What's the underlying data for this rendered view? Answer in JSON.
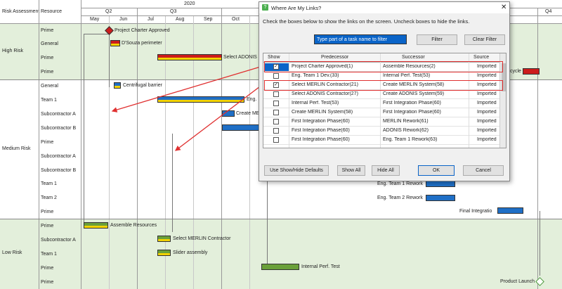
{
  "gantt": {
    "col_risk": "Risk Assessment",
    "col_resource": "Resource",
    "year": "2020",
    "quarters": [
      "Q2",
      "Q3",
      "Q4"
    ],
    "months": [
      "May",
      "Jun",
      "Jul",
      "Aug",
      "Sep",
      "Oct"
    ],
    "risk_groups": [
      "High Risk",
      "Medium Risk",
      "Low Risk"
    ],
    "resources": [
      "Prime",
      "General",
      "Prime",
      "Prime",
      "General",
      "Team 1",
      "Subcontractor A",
      "Subcontractor B",
      "Prime",
      "Subcontractor A",
      "Subcontractor B",
      "Team 1",
      "Team 2",
      "Prime",
      "Prime",
      "Subcontractor A",
      "Team 1",
      "Prime",
      "Prime"
    ],
    "task_labels": {
      "charter": "Project Charter Approved",
      "dsouza": "D'Souza perimeter",
      "adonis": "Select ADONIS Contr",
      "cycle": "cycle",
      "barrier": "Centrifugal barrier",
      "eng": "Eng.",
      "create_merlin": "Create MER",
      "rework1": "Eng. Team 1 Rework",
      "rework2": "Eng. Team 2 Rework",
      "final_integ": "Final Integratio",
      "assemble": "Assemble Resources",
      "select_merlin": "Select MERLIN Contractor",
      "slider": "Slider assembly",
      "internal": "Internal Perf. Test",
      "launch": "Product Launch"
    }
  },
  "dialog": {
    "title": "Where Are My Links?",
    "instruction": "Check the boxes below to show the links on the screen.  Uncheck boxes to hide the links.",
    "filter_placeholder": "Type part of a task name to filter",
    "filter_btn": "Filter",
    "clear_btn": "Clear Filter",
    "headers": [
      "Show",
      "Predecessor",
      "Successor",
      "Source"
    ],
    "rows": [
      {
        "show": true,
        "pred": "Project Charter Approved(1)",
        "succ": "Assemble Resources(2)",
        "source": "Imported"
      },
      {
        "show": false,
        "pred": "Eng. Team 1 Dev.(33)",
        "succ": "Internal Perf. Test(53)",
        "source": "Imported"
      },
      {
        "show": true,
        "pred": "Select MERLIN Contractor(21)",
        "succ": "Create MERLIN System(58)",
        "source": "Imported"
      },
      {
        "show": false,
        "pred": "Select ADONIS Contractor(27)",
        "succ": "Create ADONIS System(59)",
        "source": "Imported"
      },
      {
        "show": false,
        "pred": "Internal Perf. Test(53)",
        "succ": "First Integration Phase(60)",
        "source": "Imported"
      },
      {
        "show": false,
        "pred": "Create MERLIN System(58)",
        "succ": "First Integration Phase(60)",
        "source": "Imported"
      },
      {
        "show": false,
        "pred": "First Integration Phase(60)",
        "succ": "MERLIN Rework(61)",
        "source": "Imported"
      },
      {
        "show": false,
        "pred": "First Integration Phase(60)",
        "succ": "ADONIS Rework(62)",
        "source": "Imported"
      },
      {
        "show": false,
        "pred": "First Integration Phase(60)",
        "succ": "Eng. Team 1 Rework(63)",
        "source": "Imported"
      }
    ],
    "btn_defaults": "Use Show/Hide Defaults",
    "btn_show_all": "Show All",
    "btn_hide_all": "Hide All",
    "btn_ok": "OK",
    "btn_cancel": "Cancel"
  }
}
